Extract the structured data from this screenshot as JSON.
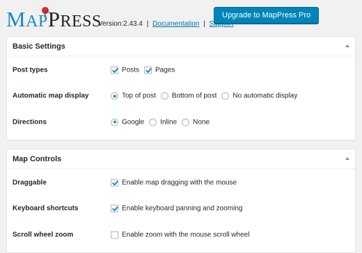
{
  "header": {
    "logo_map": "Map",
    "logo_press": "Press",
    "version": "Version:2.43.4",
    "documentation_link": "Documentation",
    "support_link": "Support",
    "separator": "|",
    "upgrade_button": "Upgrade to MapPress Pro",
    "accent_color": "#0085ba"
  },
  "basic_settings": {
    "title": "Basic Settings",
    "post_types": {
      "label": "Post types",
      "options": [
        {
          "label": "Posts",
          "checked": true
        },
        {
          "label": "Pages",
          "checked": true
        }
      ]
    },
    "automatic_map_display": {
      "label": "Automatic map display",
      "options": [
        {
          "label": "Top of post",
          "selected": true
        },
        {
          "label": "Bottom of post",
          "selected": false
        },
        {
          "label": "No automatic display",
          "selected": false
        }
      ]
    },
    "directions": {
      "label": "Directions",
      "options": [
        {
          "label": "Google",
          "selected": true
        },
        {
          "label": "Inline",
          "selected": false
        },
        {
          "label": "None",
          "selected": false
        }
      ]
    }
  },
  "map_controls": {
    "title": "Map Controls",
    "draggable": {
      "label": "Draggable",
      "option": "Enable map dragging with the mouse",
      "checked": true
    },
    "keyboard_shortcuts": {
      "label": "Keyboard shortcuts",
      "option": "Enable keyboard panning and zooming",
      "checked": true
    },
    "scroll_wheel_zoom": {
      "label": "Scroll wheel zoom",
      "option": "Enable zoom with the mouse scroll wheel",
      "checked": false
    }
  }
}
